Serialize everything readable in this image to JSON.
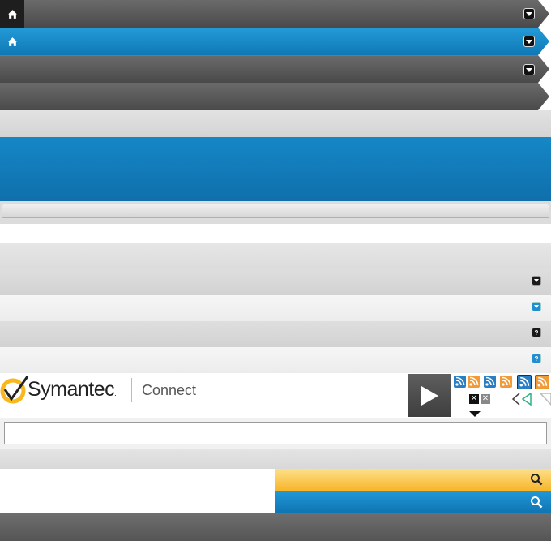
{
  "brand": {
    "name": "Symantec",
    "suffix": ".",
    "product": "Connect"
  },
  "colors": {
    "blue": "#1384c4",
    "grey": "#5a5a5a",
    "orange": "#f19a38",
    "yellow": "#fbbd2b"
  },
  "icons": {
    "home": "home-icon",
    "dropdown": "chevron-down-icon",
    "help": "question-icon",
    "rss": "rss-icon",
    "close": "close-icon",
    "play": "play-icon",
    "search": "search-icon"
  },
  "search": {
    "value": "",
    "placeholder": ""
  },
  "field": {
    "value": ""
  },
  "help_symbol": "?"
}
